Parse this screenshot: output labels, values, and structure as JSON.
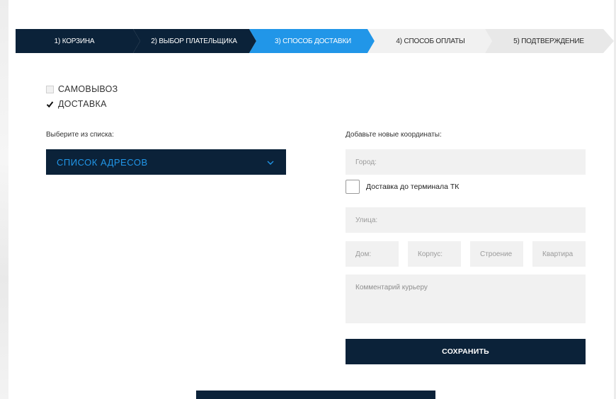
{
  "steps": [
    {
      "label": "1) КОРЗИНА",
      "state": "done"
    },
    {
      "label": "2) ВЫБОР ПЛАТЕЛЬЩИКА",
      "state": "done"
    },
    {
      "label": "3) СПОСОБ ДОСТАВКИ",
      "state": "active"
    },
    {
      "label": "4) СПОСОБ ОПЛАТЫ",
      "state": "pending"
    },
    {
      "label": "5) ПОДТВЕРЖДЕНИЕ",
      "state": "pending"
    }
  ],
  "delivery_options": {
    "pickup": {
      "label": "САМОВЫВОЗ",
      "checked": false
    },
    "delivery": {
      "label": "ДОСТАВКА",
      "checked": true
    }
  },
  "left": {
    "heading": "Выберите из списка:",
    "select_label": "СПИСОК АДРЕСОВ"
  },
  "right": {
    "heading": "Добавьте новые координаты:",
    "city_placeholder": "Город:",
    "terminal_label": "Доставка до терминала ТК",
    "street_placeholder": "Улица:",
    "house_placeholder": "Дом:",
    "building_placeholder": "Корпус:",
    "structure_placeholder": "Строение",
    "apartment_placeholder": "Квартира",
    "comment_placeholder": "Комментарий курьеру",
    "save_label": "СОХРАНИТЬ"
  },
  "colors": {
    "navy": "#0b2239",
    "accent_blue": "#2196e8",
    "field_grey": "#f1f1f1"
  }
}
